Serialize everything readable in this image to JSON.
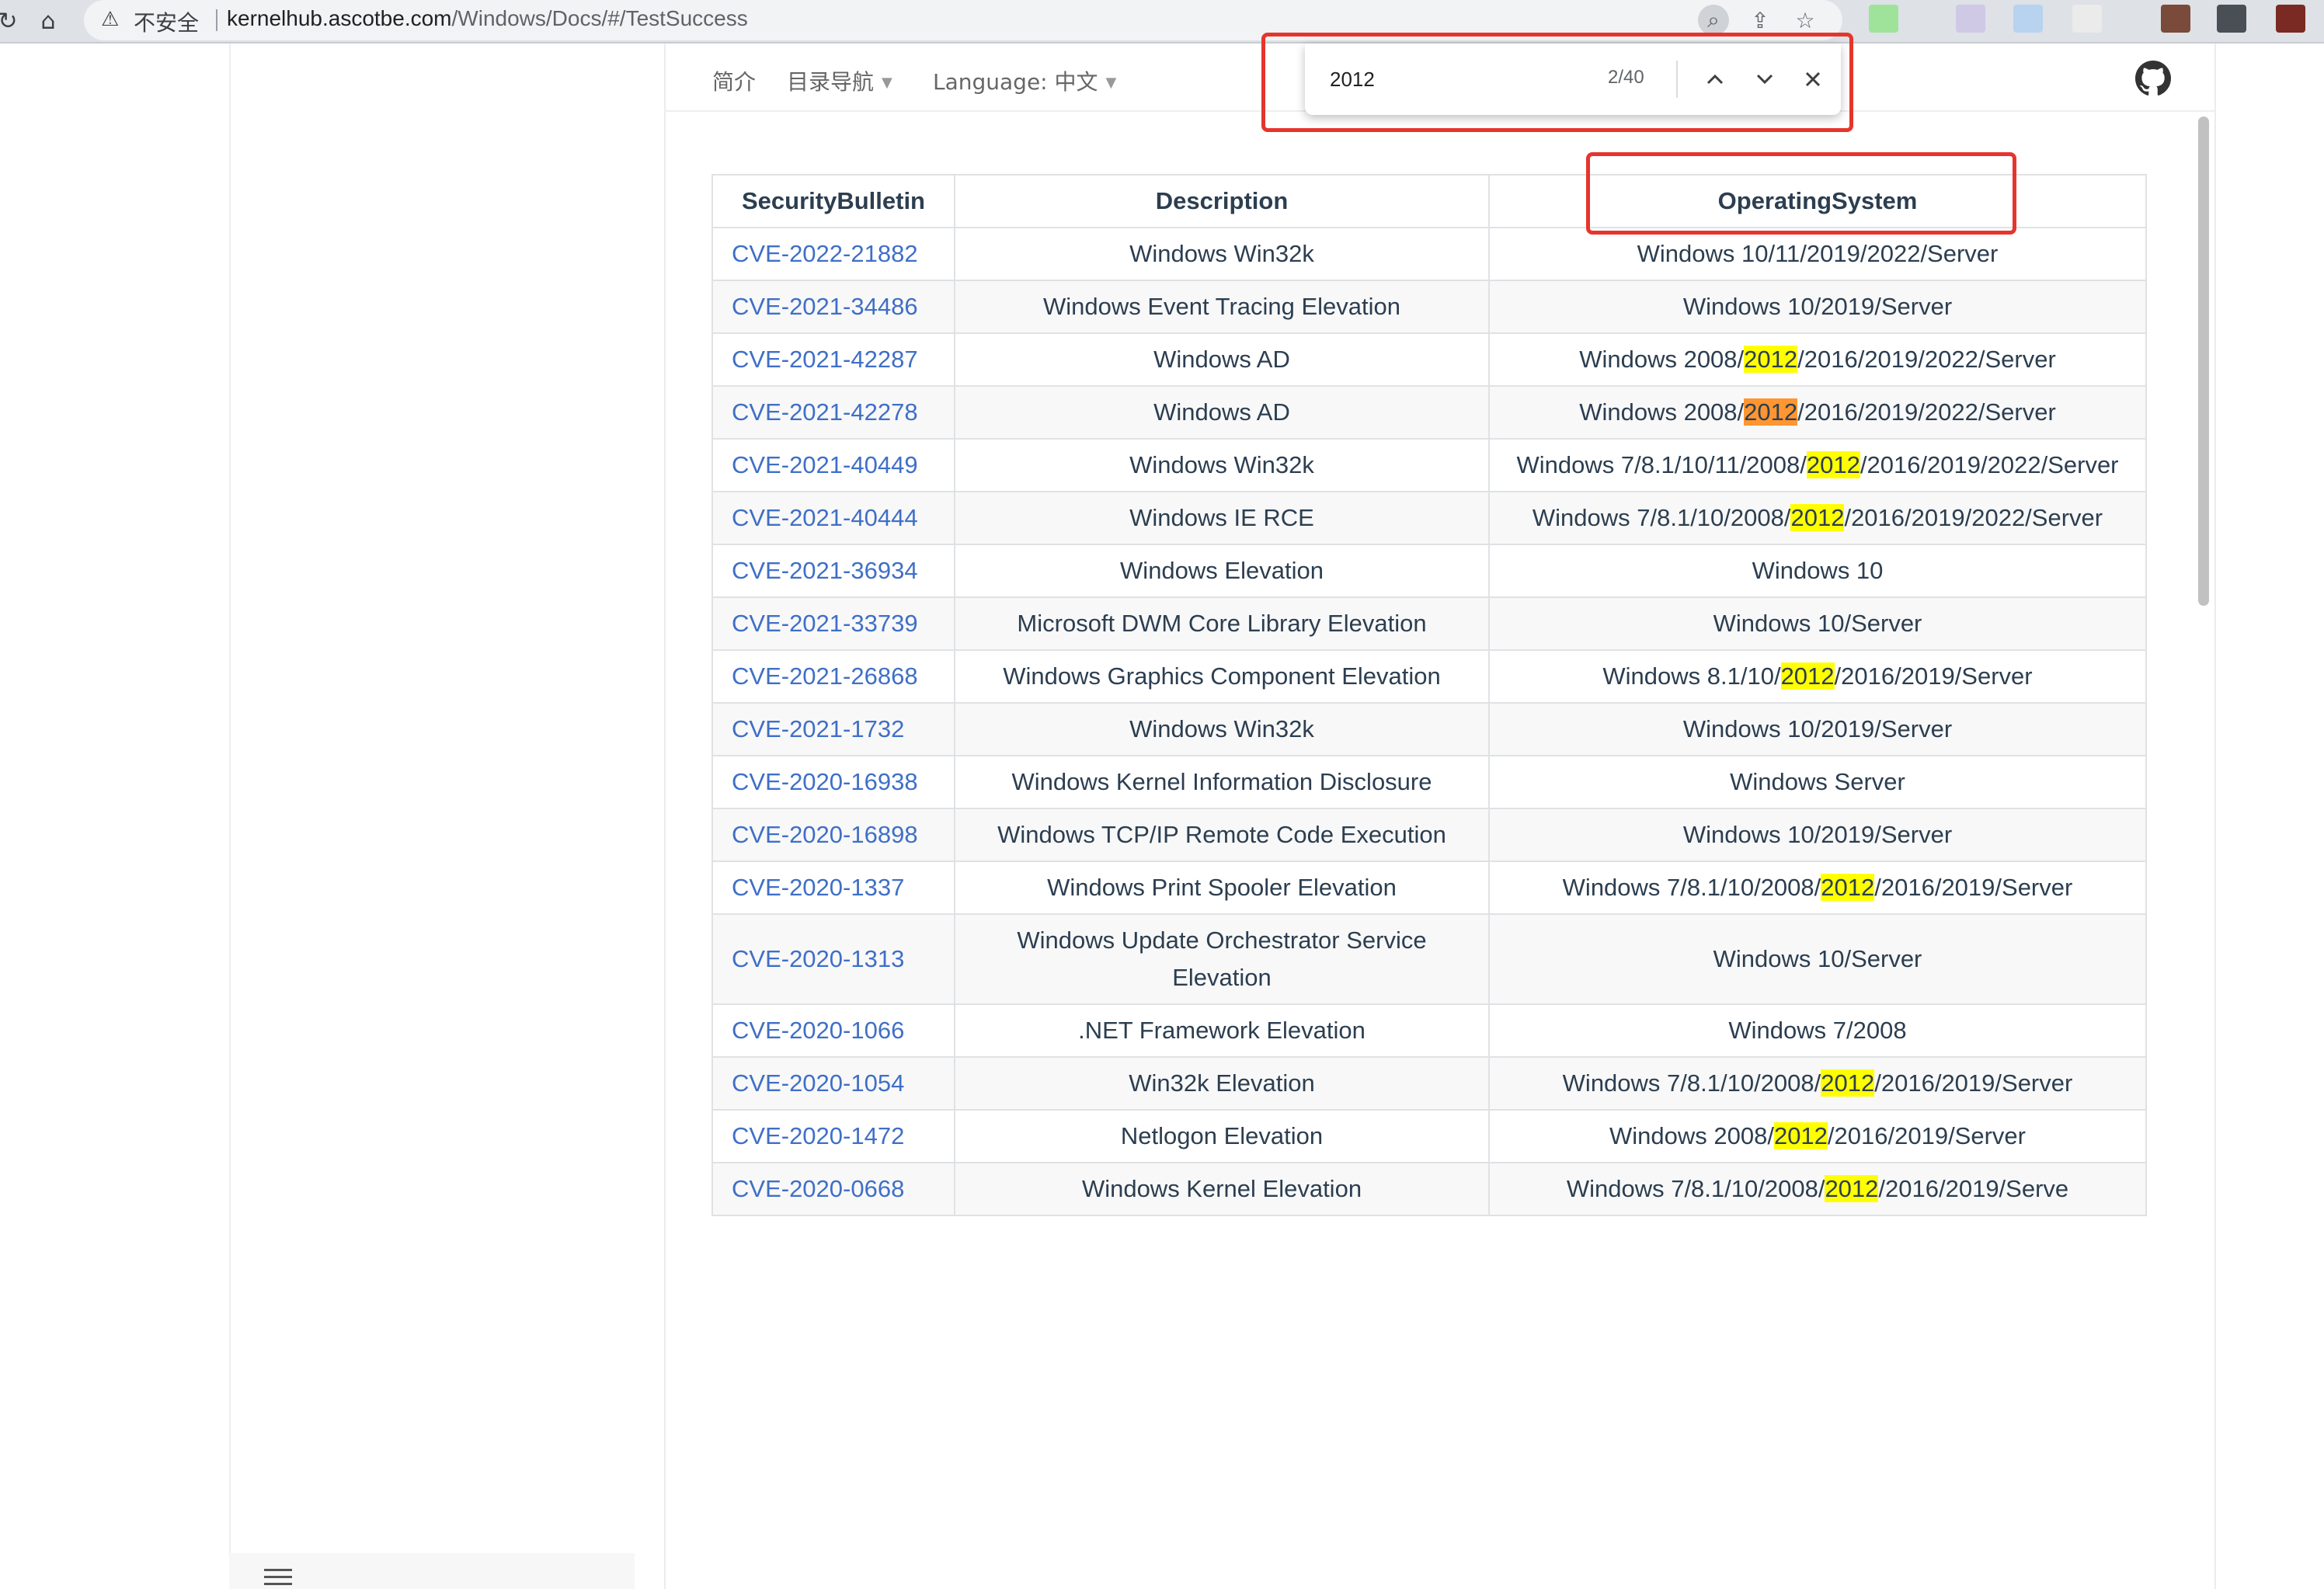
{
  "browser": {
    "security_label": "不安全",
    "url_host": "kernelhub.ascotbe.com",
    "url_path": "/Windows/Docs/#/TestSuccess"
  },
  "topnav": {
    "intro": "简介",
    "toc": "目录导航",
    "language": "Language: 中文"
  },
  "find": {
    "query": "2012",
    "count": "2/40"
  },
  "table": {
    "headers": [
      "SecurityBulletin",
      "Description",
      "OperatingSystem"
    ],
    "rows": [
      {
        "cve": "CVE-2022-21882",
        "desc": "Windows Win32k",
        "os_pre": "Windows 10/11/2019/2022/Server",
        "os_hit": "",
        "os_post": ""
      },
      {
        "cve": "CVE-2021-34486",
        "desc": "Windows Event Tracing Elevation",
        "os_pre": "Windows 10/2019/Server",
        "os_hit": "",
        "os_post": ""
      },
      {
        "cve": "CVE-2021-42287",
        "desc": "Windows AD",
        "os_pre": "Windows 2008/",
        "os_hit": "2012",
        "os_post": "/2016/2019/2022/Server"
      },
      {
        "cve": "CVE-2021-42278",
        "desc": "Windows AD",
        "os_pre": "Windows 2008/",
        "os_hit": "2012",
        "os_post": "/2016/2019/2022/Server"
      },
      {
        "cve": "CVE-2021-40449",
        "desc": "Windows Win32k",
        "os_pre": "Windows 7/8.1/10/11/2008/",
        "os_hit": "2012",
        "os_post": "/2016/2019/2022/Server"
      },
      {
        "cve": "CVE-2021-40444",
        "desc": "Windows IE RCE",
        "os_pre": "Windows 7/8.1/10/2008/",
        "os_hit": "2012",
        "os_post": "/2016/2019/2022/Server"
      },
      {
        "cve": "CVE-2021-36934",
        "desc": "Windows Elevation",
        "os_pre": "Windows 10",
        "os_hit": "",
        "os_post": ""
      },
      {
        "cve": "CVE-2021-33739",
        "desc": "Microsoft DWM Core Library Elevation",
        "os_pre": "Windows 10/Server",
        "os_hit": "",
        "os_post": ""
      },
      {
        "cve": "CVE-2021-26868",
        "desc": "Windows Graphics Component Elevation",
        "os_pre": "Windows 8.1/10/",
        "os_hit": "2012",
        "os_post": "/2016/2019/Server"
      },
      {
        "cve": "CVE-2021-1732",
        "desc": "Windows Win32k",
        "os_pre": "Windows 10/2019/Server",
        "os_hit": "",
        "os_post": ""
      },
      {
        "cve": "CVE-2020-16938",
        "desc": "Windows Kernel Information Disclosure",
        "os_pre": "Windows Server",
        "os_hit": "",
        "os_post": ""
      },
      {
        "cve": "CVE-2020-16898",
        "desc": "Windows TCP/IP Remote Code Execution",
        "os_pre": "Windows 10/2019/Server",
        "os_hit": "",
        "os_post": ""
      },
      {
        "cve": "CVE-2020-1337",
        "desc": "Windows Print Spooler Elevation",
        "os_pre": "Windows 7/8.1/10/2008/",
        "os_hit": "2012",
        "os_post": "/2016/2019/Server"
      },
      {
        "cve": "CVE-2020-1313",
        "desc": "Windows Update Orchestrator Service Elevation",
        "os_pre": "Windows 10/Server",
        "os_hit": "",
        "os_post": ""
      },
      {
        "cve": "CVE-2020-1066",
        "desc": ".NET Framework Elevation",
        "os_pre": "Windows 7/2008",
        "os_hit": "",
        "os_post": ""
      },
      {
        "cve": "CVE-2020-1054",
        "desc": "Win32k Elevation",
        "os_pre": "Windows 7/8.1/10/2008/",
        "os_hit": "2012",
        "os_post": "/2016/2019/Server"
      },
      {
        "cve": "CVE-2020-1472",
        "desc": "Netlogon Elevation",
        "os_pre": "Windows 2008/",
        "os_hit": "2012",
        "os_post": "/2016/2019/Server"
      },
      {
        "cve": "CVE-2020-0668",
        "desc": "Windows Kernel Elevation",
        "os_pre": "Windows 7/8.1/10/2008/",
        "os_hit": "2012",
        "os_post": "/2016/2019/Serve"
      }
    ]
  },
  "colors": {
    "link": "#3f6fc7",
    "highlight": "#ffff00",
    "current_highlight": "#ff9632",
    "annotation": "#e5352c"
  }
}
